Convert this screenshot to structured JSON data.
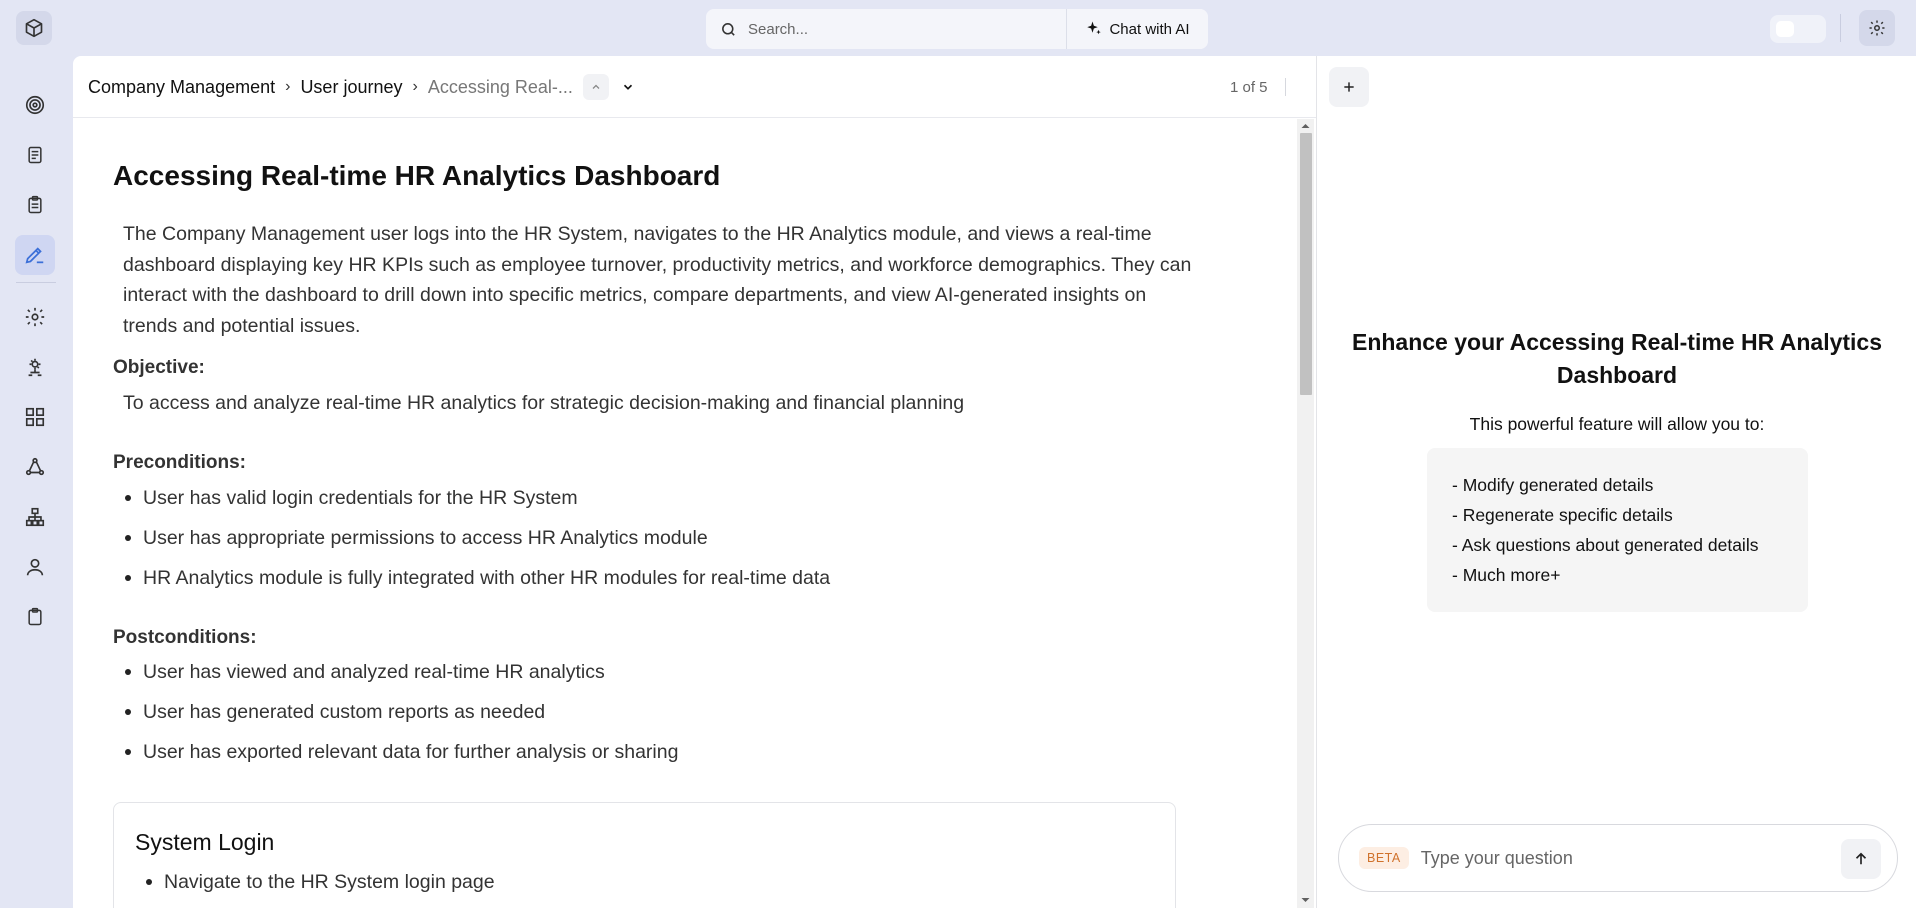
{
  "search": {
    "placeholder": "Search...",
    "chat_label": "Chat with AI"
  },
  "sidebar": {
    "items": [
      {
        "icon": "target-icon"
      },
      {
        "icon": "document-icon"
      },
      {
        "icon": "clipboard-list-icon"
      },
      {
        "icon": "pen-tool-icon",
        "active": true
      },
      {
        "icon": "gear-icon"
      },
      {
        "icon": "network-gear-icon"
      },
      {
        "icon": "dashboard-grid-icon"
      },
      {
        "icon": "cycle-icon"
      },
      {
        "icon": "hierarchy-icon"
      },
      {
        "icon": "user-icon"
      },
      {
        "icon": "clipboard-icon"
      }
    ]
  },
  "breadcrumb": {
    "items": [
      "Company Management",
      "User journey",
      "Accessing Real-..."
    ],
    "page_count": "1 of 5"
  },
  "doc": {
    "title": "Accessing Real-time HR Analytics Dashboard",
    "description": "The Company Management user logs into the HR System, navigates to the HR Analytics module, and views a real-time dashboard displaying key HR KPIs such as employee turnover, productivity metrics, and workforce demographics. They can interact with the dashboard to drill down into specific metrics, compare departments, and view AI-generated insights on trends and potential issues.",
    "objective_label": "Objective:",
    "objective": "To access and analyze real-time HR analytics for strategic decision-making and financial planning",
    "preconditions_label": "Preconditions:",
    "preconditions": [
      "User has valid login credentials for the HR System",
      "User has appropriate permissions to access HR Analytics module",
      "HR Analytics module is fully integrated with other HR modules for real-time data"
    ],
    "postconditions_label": "Postconditions:",
    "postconditions": [
      "User has viewed and analyzed real-time HR analytics",
      "User has generated custom reports as needed",
      "User has exported relevant data for further analysis or sharing"
    ],
    "step": {
      "title": "System Login",
      "items": [
        "Navigate to the HR System login page"
      ]
    }
  },
  "panel": {
    "title": "Enhance your Accessing Real-time HR Analytics Dashboard",
    "subtitle": "This powerful feature will allow you to:",
    "features": [
      "- Modify generated details",
      "- Regenerate specific details",
      "- Ask questions about generated details",
      "- Much more+"
    ],
    "beta_label": "BETA",
    "chat_placeholder": "Type your question"
  },
  "colors": {
    "accent": "#3b6fd8",
    "sidebar_bg": "#e3e6f4",
    "active_item_bg": "#cfd6f2",
    "beta_text": "#d0722c"
  }
}
